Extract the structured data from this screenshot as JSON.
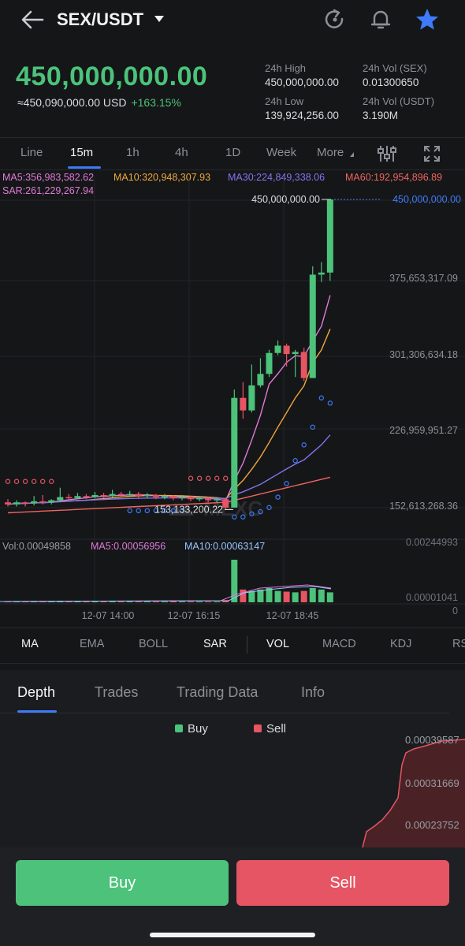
{
  "header": {
    "pair": "SEX/USDT",
    "back_icon": "arrow-left-icon",
    "icons": [
      "refresh-icon",
      "bell-icon",
      "star-icon"
    ]
  },
  "ticker": {
    "last_price": "450,000,000.00",
    "usd_value": "≈450,090,000.00 USD",
    "change": "+163.15%",
    "high_label": "24h High",
    "high_value": "450,000,000.00",
    "low_label": "24h Low",
    "low_value": "139,924,256.00",
    "vol_base_label": "24h Vol (SEX)",
    "vol_base_value": "0.01300650",
    "vol_quote_label": "24h Vol  (USDT)",
    "vol_quote_value": "3.190M"
  },
  "intervals": {
    "items": [
      "Line",
      "15m",
      "1h",
      "4h",
      "1D",
      "Week",
      "More"
    ],
    "active": "15m"
  },
  "indicators_top": {
    "ma5": "MA5:356,983,582.62",
    "ma10": "MA10:320,948,307.93",
    "ma30": "MA30:224,849,338.06",
    "ma60": "MA60:192,954,896.89",
    "sar": "SAR:261,229,267.94"
  },
  "chart": {
    "watermark": "MEXC",
    "last_price_tag": "450,000,000.00",
    "high_marker": "450,000,000.00",
    "low_marker": "153,133,200.22",
    "y_labels": [
      "375,653,317.09",
      "301,306,634.18",
      "226,959,951.27",
      "152,613,268.36"
    ],
    "x_labels": [
      "12-07 14:00",
      "12-07 16:15",
      "12-07 18:45"
    ]
  },
  "chart_data": {
    "type": "candlestick",
    "interval": "15m",
    "ylim": [
      130000000,
      460000000
    ],
    "y_ticks": [
      375653317.09,
      301306634.18,
      226959951.27,
      152613268.36
    ],
    "candles": [
      {
        "o": 160,
        "c": 158,
        "h": 163,
        "l": 156
      },
      {
        "o": 158,
        "c": 160,
        "h": 162,
        "l": 156
      },
      {
        "o": 160,
        "c": 159,
        "h": 161,
        "l": 156
      },
      {
        "o": 159,
        "c": 161,
        "h": 166,
        "l": 157
      },
      {
        "o": 161,
        "c": 160,
        "h": 167,
        "l": 158
      },
      {
        "o": 160,
        "c": 162,
        "h": 163,
        "l": 158
      },
      {
        "o": 162,
        "c": 165,
        "h": 174,
        "l": 160
      },
      {
        "o": 165,
        "c": 164,
        "h": 168,
        "l": 162
      },
      {
        "o": 164,
        "c": 166,
        "h": 169,
        "l": 163
      },
      {
        "o": 166,
        "c": 165,
        "h": 168,
        "l": 163
      },
      {
        "o": 165,
        "c": 167,
        "h": 170,
        "l": 164
      },
      {
        "o": 167,
        "c": 166,
        "h": 169,
        "l": 164
      },
      {
        "o": 166,
        "c": 168,
        "h": 172,
        "l": 165
      },
      {
        "o": 168,
        "c": 167,
        "h": 170,
        "l": 165
      },
      {
        "o": 167,
        "c": 168,
        "h": 171,
        "l": 165
      },
      {
        "o": 168,
        "c": 166,
        "h": 170,
        "l": 164
      },
      {
        "o": 166,
        "c": 167,
        "h": 169,
        "l": 164
      },
      {
        "o": 167,
        "c": 165,
        "h": 168,
        "l": 163
      },
      {
        "o": 165,
        "c": 166,
        "h": 168,
        "l": 163
      },
      {
        "o": 166,
        "c": 164,
        "h": 167,
        "l": 162
      },
      {
        "o": 164,
        "c": 165,
        "h": 167,
        "l": 162
      },
      {
        "o": 165,
        "c": 163,
        "h": 166,
        "l": 161
      },
      {
        "o": 163,
        "c": 164,
        "h": 166,
        "l": 161
      },
      {
        "o": 164,
        "c": 162,
        "h": 165,
        "l": 160
      },
      {
        "o": 162,
        "c": 163,
        "h": 165,
        "l": 160
      },
      {
        "o": 163,
        "c": 155,
        "h": 164,
        "l": 153
      },
      {
        "o": 155,
        "c": 260,
        "h": 268,
        "l": 155
      },
      {
        "o": 260,
        "c": 248,
        "h": 275,
        "l": 240
      },
      {
        "o": 248,
        "c": 272,
        "h": 292,
        "l": 246
      },
      {
        "o": 272,
        "c": 283,
        "h": 298,
        "l": 270
      },
      {
        "o": 283,
        "c": 303,
        "h": 306,
        "l": 280
      },
      {
        "o": 303,
        "c": 310,
        "h": 315,
        "l": 301
      },
      {
        "o": 310,
        "c": 302,
        "h": 312,
        "l": 290
      },
      {
        "o": 302,
        "c": 304,
        "h": 306,
        "l": 280
      },
      {
        "o": 304,
        "c": 279,
        "h": 308,
        "l": 276
      },
      {
        "o": 279,
        "c": 378,
        "h": 386,
        "l": 279
      },
      {
        "o": 378,
        "c": 380,
        "h": 390,
        "l": 371
      },
      {
        "o": 380,
        "c": 450,
        "h": 450,
        "l": 372
      }
    ],
    "volume_ticks": [
      "0.00244993",
      "0.00001041",
      "0"
    ]
  },
  "volume": {
    "vol": "Vol:0.00049858",
    "ma5": "MA5:0.00056956",
    "ma10": "MA10:0.00063147"
  },
  "indicator_tabs": [
    "MA",
    "EMA",
    "BOLL",
    "SAR",
    "VOL",
    "MACD",
    "KDJ",
    "RS"
  ],
  "panel": {
    "tabs": [
      "Depth",
      "Trades",
      "Trading Data",
      "Info"
    ],
    "active": "Depth",
    "legend_buy": "Buy",
    "legend_sell": "Sell",
    "depth_labels": [
      "0.00039587",
      "0.00031669",
      "0.00023752"
    ]
  },
  "actions": {
    "buy": "Buy",
    "sell": "Sell"
  },
  "colors": {
    "green": "#4cc27a",
    "red": "#e55563",
    "accent": "#3e7bfa",
    "background": "#151618"
  }
}
